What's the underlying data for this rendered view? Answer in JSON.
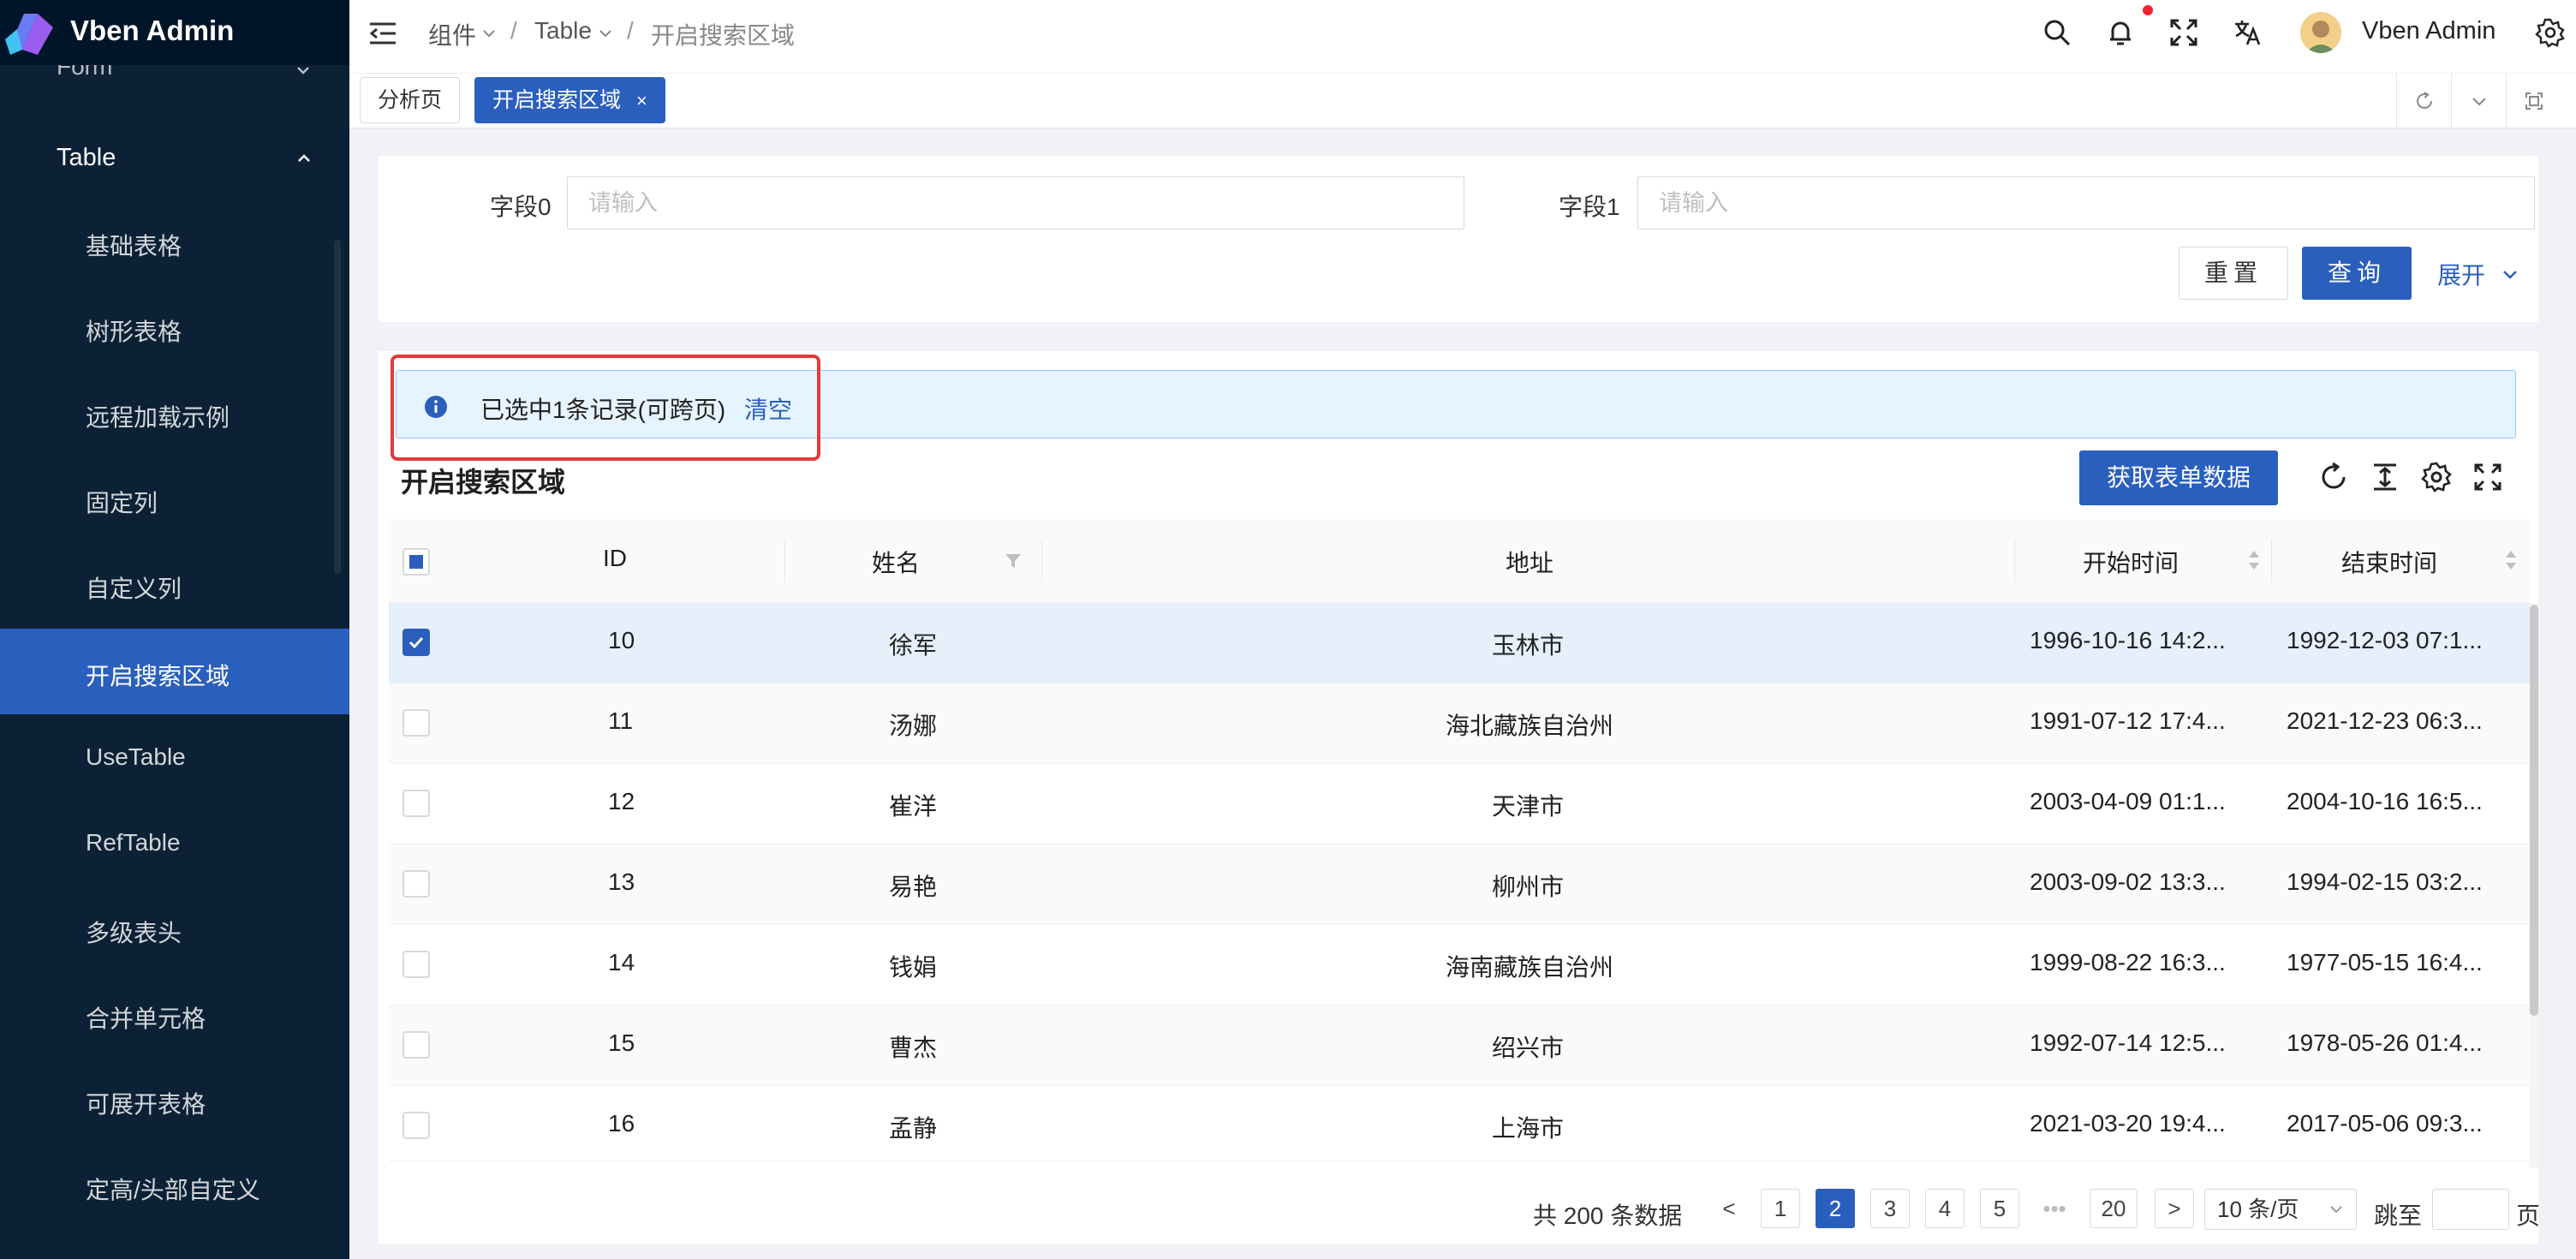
{
  "app": {
    "name": "Vben Admin"
  },
  "sidebar": {
    "cut_item": "Form",
    "parent": "Table",
    "items": [
      {
        "label": "基础表格",
        "active": false
      },
      {
        "label": "树形表格",
        "active": false
      },
      {
        "label": "远程加载示例",
        "active": false
      },
      {
        "label": "固定列",
        "active": false
      },
      {
        "label": "自定义列",
        "active": false
      },
      {
        "label": "开启搜索区域",
        "active": true
      },
      {
        "label": "UseTable",
        "active": false
      },
      {
        "label": "RefTable",
        "active": false
      },
      {
        "label": "多级表头",
        "active": false
      },
      {
        "label": "合并单元格",
        "active": false
      },
      {
        "label": "可展开表格",
        "active": false
      },
      {
        "label": "定高/头部自定义",
        "active": false
      }
    ]
  },
  "header": {
    "breadcrumb": [
      "组件",
      "Table",
      "开启搜索区域"
    ],
    "user_name": "Vben Admin"
  },
  "tabs": [
    {
      "label": "分析页",
      "active": false
    },
    {
      "label": "开启搜索区域",
      "active": true,
      "close": "×"
    }
  ],
  "search": {
    "field0_label": "字段0",
    "field0_placeholder": "请输入",
    "field1_label": "字段1",
    "field1_placeholder": "请输入",
    "reset": "重置",
    "query": "查询",
    "expand": "展开"
  },
  "table": {
    "alert": "已选中1条记录(可跨页)",
    "clear": "清空",
    "title": "开启搜索区域",
    "get_data": "获取表单数据",
    "columns": [
      "ID",
      "姓名",
      "地址",
      "开始时间",
      "结束时间"
    ],
    "rows": [
      {
        "id": "10",
        "name": "徐军",
        "address": "玉林市",
        "start": "1996-10-16 14:2...",
        "end": "1992-12-03 07:1...",
        "selected": true
      },
      {
        "id": "11",
        "name": "汤娜",
        "address": "海北藏族自治州",
        "start": "1991-07-12 17:4...",
        "end": "2021-12-23 06:3...",
        "selected": false
      },
      {
        "id": "12",
        "name": "崔洋",
        "address": "天津市",
        "start": "2003-04-09 01:1...",
        "end": "2004-10-16 16:5...",
        "selected": false
      },
      {
        "id": "13",
        "name": "易艳",
        "address": "柳州市",
        "start": "2003-09-02 13:3...",
        "end": "1994-02-15 03:2...",
        "selected": false
      },
      {
        "id": "14",
        "name": "钱娟",
        "address": "海南藏族自治州",
        "start": "1999-08-22 16:3...",
        "end": "1977-05-15 16:4...",
        "selected": false
      },
      {
        "id": "15",
        "name": "曹杰",
        "address": "绍兴市",
        "start": "1992-07-14 12:5...",
        "end": "1978-05-26 01:4...",
        "selected": false
      },
      {
        "id": "16",
        "name": "孟静",
        "address": "上海市",
        "start": "2021-03-20 19:4...",
        "end": "2017-05-06 09:3...",
        "selected": false
      }
    ]
  },
  "pagination": {
    "total": "共 200 条数据",
    "prev": "<",
    "next": ">",
    "pages": [
      "1",
      "2",
      "3",
      "4",
      "5",
      "•••",
      "20"
    ],
    "active_page": "2",
    "page_size": "10 条/页",
    "jump_label": "跳至",
    "page_suffix": "页"
  },
  "colors": {
    "primary": "#2a5fbd",
    "sidebar_bg": "#001529",
    "alert_bg": "#e6f4ff",
    "highlight": "#e03b3b"
  }
}
